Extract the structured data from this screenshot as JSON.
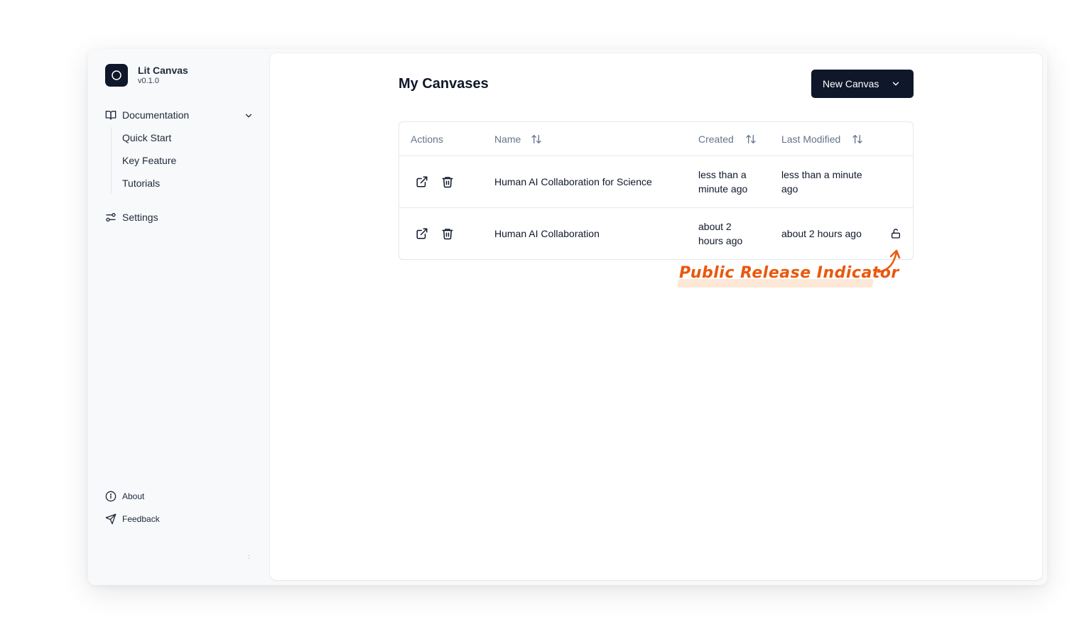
{
  "sidebar": {
    "brand": {
      "name": "Lit Canvas",
      "version": "v0.1.0",
      "logo_icon": "circle-logo-icon"
    },
    "nav": {
      "documentation": {
        "label": "Documentation",
        "icon": "book-open-icon",
        "expanded": true,
        "items": [
          {
            "label": "Quick Start"
          },
          {
            "label": "Key Feature"
          },
          {
            "label": "Tutorials"
          }
        ]
      },
      "settings": {
        "label": "Settings",
        "icon": "sliders-icon"
      }
    },
    "footer": {
      "about": {
        "label": "About",
        "icon": "info-icon"
      },
      "feedback": {
        "label": "Feedback",
        "icon": "send-icon"
      }
    }
  },
  "main": {
    "title": "My Canvases",
    "new_button": {
      "label": "New Canvas",
      "icon": "chevron-down-icon"
    },
    "table": {
      "columns": [
        {
          "label": "Actions",
          "sortable": false
        },
        {
          "label": "Name",
          "sortable": true
        },
        {
          "label": "Created",
          "sortable": true
        },
        {
          "label": "Last Modified",
          "sortable": true
        }
      ],
      "rows": [
        {
          "name": "Human AI Collaboration for Science",
          "created": [
            "less than a",
            "minute ago"
          ],
          "modified": [
            "less than a minute",
            "ago"
          ],
          "public": false
        },
        {
          "name": "Human AI Collaboration",
          "created": [
            "about 2",
            "hours ago"
          ],
          "modified": [
            "about 2 hours ago"
          ],
          "public": true
        }
      ]
    },
    "annotation": {
      "text": "Public Release Indicator"
    }
  },
  "colors": {
    "primary": "#0f172a",
    "muted_text": "#64748b",
    "border": "#e2e8f0",
    "annotation": "#ea580c",
    "sidebar_bg": "#f8f9fa"
  }
}
